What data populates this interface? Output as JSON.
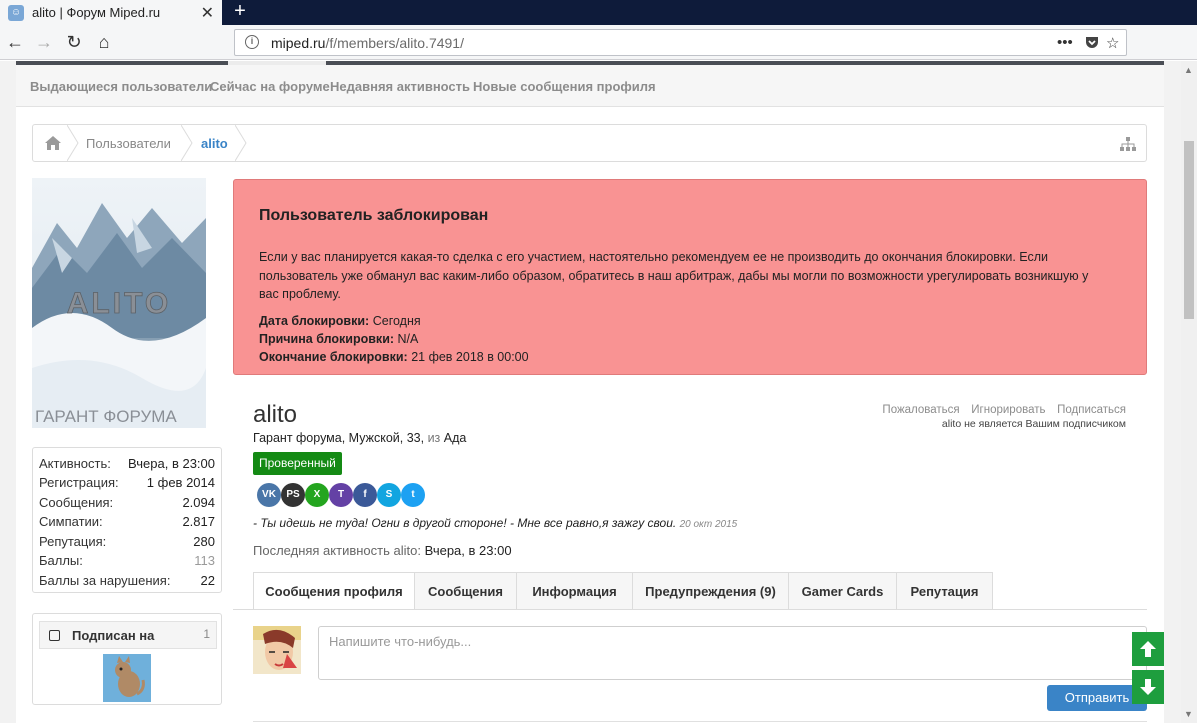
{
  "browser": {
    "tab_title": "alito | Форум Miped.ru",
    "url_host": "miped.ru",
    "url_path": "/f/members/alito.7491/"
  },
  "subnav": {
    "items": [
      "Выдающиеся пользователи",
      "Сейчас на форуме",
      "Недавняя активность",
      "Новые сообщения профиля"
    ]
  },
  "breadcrumb": {
    "items": [
      "Пользователи",
      "alito"
    ]
  },
  "avatar": {
    "logo_text": "ALITO",
    "caption": "ГАРАНТ ФОРУМА"
  },
  "stats": [
    {
      "label": "Активность:",
      "value": "Вчера, в 23:00"
    },
    {
      "label": "Регистрация:",
      "value": "1 фев 2014"
    },
    {
      "label": "Сообщения:",
      "value": "2.094"
    },
    {
      "label": "Симпатии:",
      "value": "2.817"
    },
    {
      "label": "Репутация:",
      "value": "280"
    },
    {
      "label": "Баллы:",
      "value": "113"
    },
    {
      "label": "Баллы за нарушения:",
      "value": "22"
    }
  ],
  "following": {
    "title": "Подписан на",
    "count": "1"
  },
  "ban": {
    "heading": "Пользователь заблокирован",
    "text": "Если у вас планируется какая-то сделка с его участием, настоятельно рекомендуем ее не производить до окончания блокировки. Если пользователь уже обманул вас каким-либо образом, обратитесь в наш арбитраж, дабы мы могли по возможности урегулировать возникшую у вас проблему.",
    "date_label": "Дата блокировки:",
    "date_value": "Сегодня",
    "reason_label": "Причина блокировки:",
    "reason_value": "N/A",
    "end_label": "Окончание блокировки:",
    "end_value": "21 фев 2018 в 00:00"
  },
  "profile": {
    "username": "alito",
    "title_line": "Гарант форума, Мужской, 33,",
    "from_word": "из",
    "location": "Ада",
    "verified_badge": "Проверенный",
    "status_text": "- Ты идешь не туда! Огни в другой стороне! - Мне все равно,я зажгу свои.",
    "status_date": "20 окт 2015",
    "last_activity_label": "Последняя активность alito:",
    "last_activity_value": "Вчера, в 23:00",
    "links": [
      "Пожаловаться",
      "Игнорировать",
      "Подписаться"
    ],
    "subscription_note": "alito не является Вашим подписчиком"
  },
  "socials": [
    {
      "icon": "vk-icon",
      "glyph": "VK",
      "color": "#4a76a8"
    },
    {
      "icon": "playstation-icon",
      "glyph": "PS",
      "color": "#333333"
    },
    {
      "icon": "xbox-icon",
      "glyph": "X",
      "color": "#24a51f"
    },
    {
      "icon": "twitch-icon",
      "glyph": "T",
      "color": "#6441a5"
    },
    {
      "icon": "facebook-icon",
      "glyph": "f",
      "color": "#3b5998"
    },
    {
      "icon": "skype-icon",
      "glyph": "S",
      "color": "#12a5e0"
    },
    {
      "icon": "twitter-icon",
      "glyph": "t",
      "color": "#1da1f2"
    }
  ],
  "tabs": [
    "Сообщения профиля",
    "Сообщения",
    "Информация",
    "Предупреждения (9)",
    "Gamer Cards",
    "Репутация"
  ],
  "post_form": {
    "placeholder": "Напишите что-нибудь...",
    "submit": "Отправить"
  },
  "colors": {
    "ban_bg": "#f99393",
    "verified": "#148a14",
    "accent_link": "#3a84c7",
    "scroll_arrows": "#1e9e3e"
  }
}
